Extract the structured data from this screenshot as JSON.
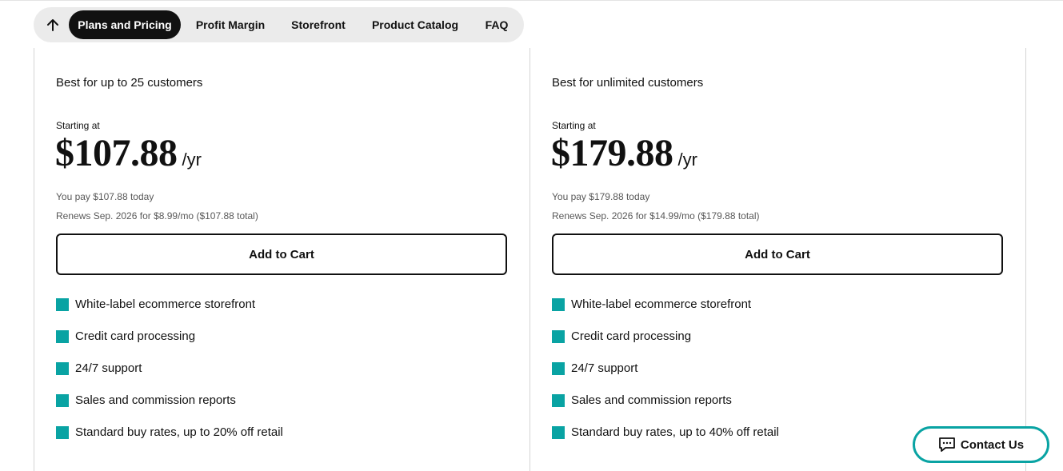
{
  "nav": {
    "items": [
      {
        "label": "Plans and Pricing",
        "active": true
      },
      {
        "label": "Profit Margin",
        "active": false
      },
      {
        "label": "Storefront",
        "active": false
      },
      {
        "label": "Product Catalog",
        "active": false
      },
      {
        "label": "FAQ",
        "active": false
      }
    ],
    "up_icon": "arrow-up-icon"
  },
  "plans": [
    {
      "tagline": "Best for up to 25 customers",
      "starting_label": "Starting at",
      "price": "$107.88",
      "period": "/yr",
      "pay_today": "You pay $107.88 today",
      "renews": "Renews Sep. 2026 for $8.99/mo ($107.88 total)",
      "cta": "Add to Cart",
      "features": [
        "White-label ecommerce storefront",
        "Credit card processing",
        "24/7 support",
        "Sales and commission reports",
        "Standard buy rates, up to 20% off retail"
      ]
    },
    {
      "tagline": "Best for unlimited customers",
      "starting_label": "Starting at",
      "price": "$179.88",
      "period": "/yr",
      "pay_today": "You pay $179.88 today",
      "renews": "Renews Sep. 2026 for $14.99/mo ($179.88 total)",
      "cta": "Add to Cart",
      "features": [
        "White-label ecommerce storefront",
        "Credit card processing",
        "24/7 support",
        "Sales and commission reports",
        "Standard buy rates, up to 40% off retail"
      ]
    }
  ],
  "contact": {
    "label": "Contact Us",
    "icon": "chat-icon"
  },
  "colors": {
    "accent": "#09a3a3",
    "nav_active_bg": "#111111",
    "nav_bg": "#ebebeb",
    "border": "#d4d4d4"
  }
}
